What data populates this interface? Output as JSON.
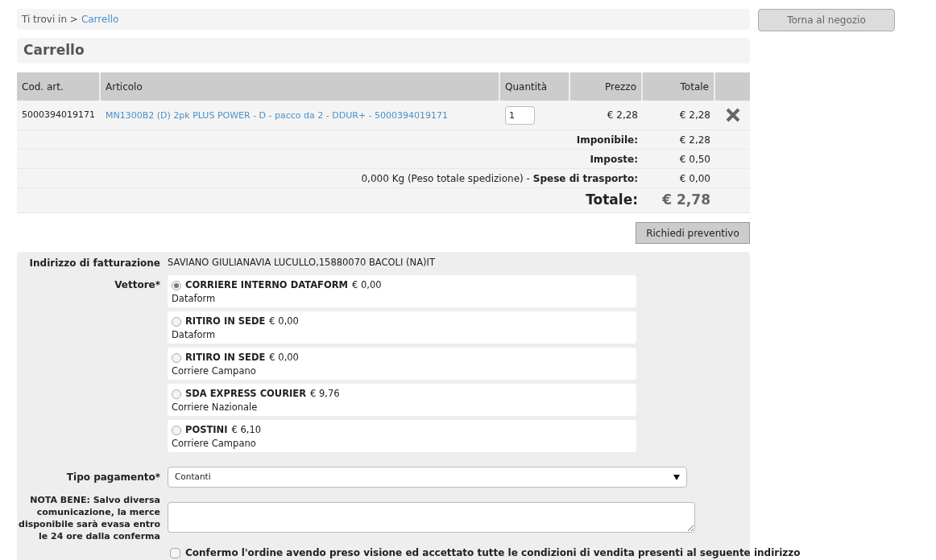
{
  "breadcrumb": {
    "prefix": "Ti trovi in >",
    "current": "Carrello"
  },
  "back_button": "Torna al negozio",
  "title": "Carrello",
  "table": {
    "columns": [
      "Cod. art.",
      "Articolo",
      "Quantità",
      "Prezzo",
      "Totale"
    ],
    "rows": [
      {
        "code": "5000394019171",
        "article": "MN1300B2 (D) 2pk PLUS POWER - D - pacco da 2 - DDUR+ - 5000394019171",
        "quantity": "1",
        "price": "€ 2,28",
        "total": "€ 2,28"
      }
    ],
    "summary": [
      {
        "kind": "line",
        "label": "Imponibile:",
        "value": "€ 2,28"
      },
      {
        "kind": "line",
        "label": "Imposte:",
        "value": "€ 0,50"
      },
      {
        "kind": "line",
        "note": "0,000 Kg (Peso totale spedizione) -",
        "label": "Spese di trasporto:",
        "value": "€ 0,00"
      },
      {
        "kind": "grand",
        "label": "Totale:",
        "value": "€ 2,78"
      }
    ]
  },
  "quote_button": "Richiedi preventivo",
  "form": {
    "billing_label": "Indirizzo di fatturazione",
    "billing_value": "SAVIANO GIULIANAVIA LUCULLO,15880070 BACOLI (NA)IT",
    "carrier_label": "Vettore*",
    "carriers": [
      {
        "name": "CORRIERE INTERNO DATAFORM",
        "price": "€ 0,00",
        "sub": "Dataform",
        "selected": true
      },
      {
        "name": "RITIRO IN SEDE",
        "price": "€ 0,00",
        "sub": "Dataform",
        "selected": false
      },
      {
        "name": "RITIRO IN SEDE",
        "price": "€ 0,00",
        "sub": "Corriere Campano",
        "selected": false
      },
      {
        "name": "SDA EXPRESS COURIER",
        "price": "€ 9,76",
        "sub": "Corriere Nazionale",
        "selected": false
      },
      {
        "name": "POSTINI",
        "price": "€ 6,10",
        "sub": "Corriere Campano",
        "selected": false
      }
    ],
    "payment_label": "Tipo pagamento*",
    "payment_value": "Contanti",
    "note_label": "NOTA BENE: Salvo diversa comunicazione, la merce disponibile sarà evasa entro le 24 ore dalla conferma",
    "confirm": {
      "text": "Confermo l'ordine avendo preso visione ed accettato tutte le condizioni di vendita presenti al seguente indirizzo",
      "checked": false
    }
  }
}
